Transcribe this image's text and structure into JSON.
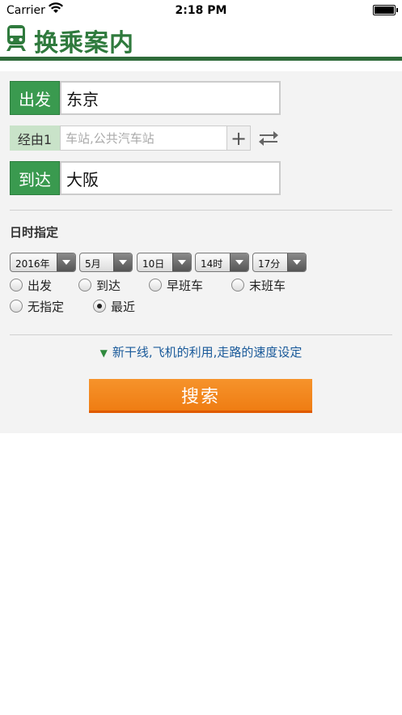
{
  "status": {
    "carrier": "Carrier",
    "time": "2:18 PM"
  },
  "header": {
    "title": "换乘案内"
  },
  "from": {
    "tag": "出发",
    "value": "东京"
  },
  "via": {
    "tag": "经由1",
    "placeholder": "车站,公共汽车站",
    "add": "+"
  },
  "to": {
    "tag": "到达",
    "value": "大阪"
  },
  "datetime": {
    "title": "日时指定",
    "year": "2016年",
    "month": "5月",
    "day": "10日",
    "hour": "14时",
    "minute": "17分"
  },
  "options": {
    "depart": "出发",
    "arrive": "到达",
    "first": "早班车",
    "last": "末班车",
    "none": "无指定",
    "recent": "最近",
    "selected": "recent"
  },
  "speed_link": "新干线,飞机的利用,走路的速度设定",
  "search_label": "搜索",
  "colors": {
    "brand_green": "#2f7a3d",
    "accent_orange": "#f28a1e",
    "link_blue": "#1a5a9a"
  }
}
